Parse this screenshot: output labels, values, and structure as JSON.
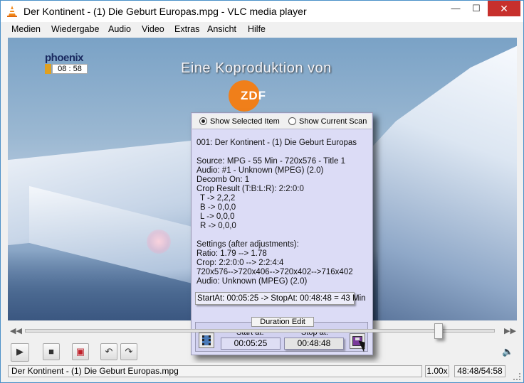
{
  "window": {
    "title": "Der Kontinent - (1) Die Geburt Europas.mpg - VLC media player"
  },
  "titlebar_buttons": {
    "minimize": "—",
    "maximize": "☐",
    "close": "✕"
  },
  "menu": [
    "Medien",
    "Wiedergabe",
    "Audio",
    "Video",
    "Extras",
    "Ansicht",
    "Hilfe"
  ],
  "video": {
    "channel_logo": "phoenix",
    "channel_time": "08 : 58",
    "caption": "Eine Koproduktion von",
    "broadcaster_logo": "ZDF"
  },
  "info_panel": {
    "radio_selected_item": "Show Selected Item",
    "radio_current_scan": "Show Current Scan",
    "selected": "Show Selected Item",
    "lines": [
      "001: Der Kontinent - (1) Die Geburt Europas",
      "",
      "Source:   MPG - 55 Min  - 720x576 - Title 1",
      "Audio: #1 - Unknown (MPEG) (2.0)",
      "Decomb On: 1",
      "Crop Result (T:B:L:R):  2:2:0:0",
      "  T -> 2,2,2",
      "  B -> 0,0,0",
      "  L -> 0,0,0",
      "  R -> 0,0,0",
      "",
      "Settings (after adjustments):",
      "Ratio: 1.79 --> 1.78",
      "Crop: 2:2:0:0 --> 2:2:4:4",
      "720x576-->720x406-->720x402-->716x402",
      "Audio: Unknown (MPEG) (2.0)"
    ],
    "start_stop_summary": "StartAt: 00:05:25 -> StopAt: 00:48:48 = 43 Min",
    "duration_edit": {
      "title": "Duration Edit",
      "start_label": "Start at:",
      "stop_label": "Stop at:",
      "start_value": "00:05:25",
      "stop_value": "00:48:48"
    }
  },
  "player": {
    "skip_back": "◀◀",
    "skip_forward": "▶▶",
    "seek_fraction": 0.88,
    "buttons": {
      "play": "▶",
      "stop": "■",
      "frame": "▣",
      "undo": "↶",
      "redo": "↷"
    },
    "volume": "🔈"
  },
  "status": {
    "filename": "Der Kontinent - (1) Die Geburt Europas.mpg",
    "speed": "1.00x",
    "time": "48:48/54:58"
  }
}
